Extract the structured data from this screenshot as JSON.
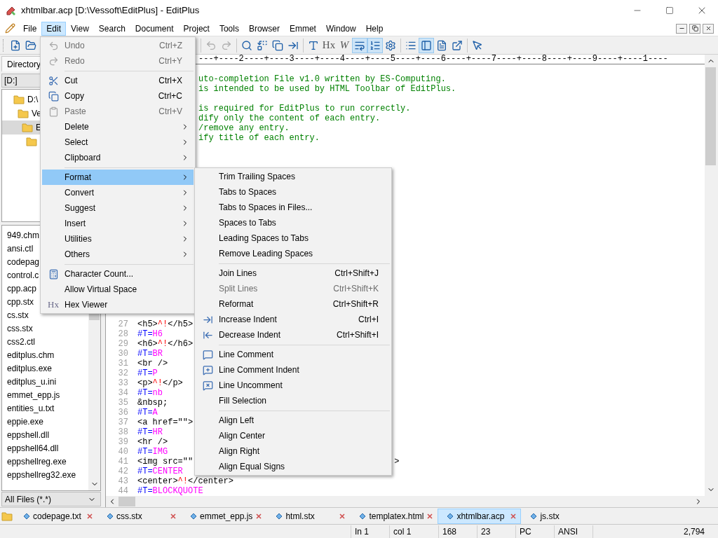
{
  "window": {
    "title": "xhtmlbar.acp [D:\\Vessoft\\EditPlus] - EditPlus"
  },
  "menu_bar": [
    {
      "label": "File",
      "selected": false
    },
    {
      "label": "Edit",
      "selected": true
    },
    {
      "label": "View",
      "selected": false
    },
    {
      "label": "Search",
      "selected": false
    },
    {
      "label": "Document",
      "selected": false
    },
    {
      "label": "Project",
      "selected": false
    },
    {
      "label": "Tools",
      "selected": false
    },
    {
      "label": "Browser",
      "selected": false
    },
    {
      "label": "Emmet",
      "selected": false
    },
    {
      "label": "Window",
      "selected": false
    },
    {
      "label": "Help",
      "selected": false
    }
  ],
  "toolbar": {
    "left": [
      {
        "kind": "button",
        "disabled": false,
        "pressed": false
      },
      {
        "kind": "button",
        "disabled": false,
        "pressed": false
      }
    ],
    "right": [
      {
        "kind": "separator"
      },
      {
        "kind": "button",
        "disabled": true,
        "pressed": false
      },
      {
        "kind": "button",
        "disabled": true,
        "pressed": false
      },
      {
        "kind": "separator"
      },
      {
        "kind": "button",
        "disabled": false,
        "pressed": false
      },
      {
        "kind": "button",
        "disabled": false,
        "pressed": false
      },
      {
        "kind": "button",
        "disabled": false,
        "pressed": false
      },
      {
        "kind": "button",
        "disabled": false,
        "pressed": false
      },
      {
        "kind": "separator"
      },
      {
        "kind": "button",
        "disabled": false,
        "pressed": false
      },
      {
        "kind": "glyph",
        "text": "Hx",
        "italic": false,
        "pressed": false
      },
      {
        "kind": "glyph",
        "text": "W",
        "italic": true,
        "pressed": false
      },
      {
        "kind": "button",
        "disabled": false,
        "pressed": true
      },
      {
        "kind": "button",
        "disabled": false,
        "pressed": true
      },
      {
        "kind": "button",
        "disabled": false,
        "pressed": false
      },
      {
        "kind": "separator"
      },
      {
        "kind": "button",
        "disabled": false,
        "pressed": false
      },
      {
        "kind": "button",
        "disabled": false,
        "pressed": true
      },
      {
        "kind": "button",
        "disabled": false,
        "pressed": false
      },
      {
        "kind": "button",
        "disabled": false,
        "pressed": false
      },
      {
        "kind": "separator"
      },
      {
        "kind": "button",
        "disabled": false,
        "pressed": false
      }
    ]
  },
  "left_panel": {
    "tab": "Directory",
    "drive": "[D:]",
    "tree": [
      {
        "label": "D:\\",
        "selected": false,
        "children": [
          {
            "label": "Ve",
            "selected": false,
            "children": [
              {
                "label": "E",
                "selected": true,
                "children": [
                  {
                    "selected": false
                  }
                ]
              }
            ]
          }
        ]
      }
    ],
    "files": [
      "949.chm",
      "ansi.ctl",
      "codepag",
      "control.c",
      "cpp.acp",
      "cpp.stx",
      "cs.stx",
      "css.stx",
      "css2.ctl",
      "editplus.chm",
      "editplus.exe",
      "editplus_u.ini",
      "emmet_epp.js",
      "entities_u.txt",
      "eppie.exe",
      "eppshell.dll",
      "eppshell64.dll",
      "eppshellreg.exe",
      "eppshellreg32.exe"
    ],
    "filter": "All Files (*.*)"
  },
  "editor": {
    "ruler": "---+----2----+----3----+----4----+----5----+----6----+----7----+----8----+----9----+----1----",
    "top_fragments": [
      [
        "uto-completion File v1.0 written by ES-Computing.",
        "is intended to be used by HTML Toolbar of EditPlus."
      ],
      [
        "is required for EditPlus to run correctly.",
        "dify only the content of each entry.",
        "/remove any entry.",
        "ify title of each entry."
      ]
    ],
    "lines": [
      {
        "number": "27",
        "parts": [
          {
            "kind": "tag",
            "text": "<h5>"
          },
          {
            "kind": "caret",
            "text": "^!"
          },
          {
            "kind": "tag",
            "text": "</h5>"
          }
        ]
      },
      {
        "number": "28",
        "parts": [
          {
            "kind": "directive",
            "text": "#T="
          },
          {
            "kind": "name",
            "text": "H6"
          }
        ]
      },
      {
        "number": "29",
        "parts": [
          {
            "kind": "tag",
            "text": "<h6>"
          },
          {
            "kind": "caret",
            "text": "^!"
          },
          {
            "kind": "tag",
            "text": "</h6>"
          }
        ]
      },
      {
        "number": "30",
        "parts": [
          {
            "kind": "directive",
            "text": "#T="
          },
          {
            "kind": "name",
            "text": "BR"
          }
        ]
      },
      {
        "number": "31",
        "parts": [
          {
            "kind": "tag",
            "text": "<br />"
          }
        ]
      },
      {
        "number": "32",
        "parts": [
          {
            "kind": "directive",
            "text": "#T="
          },
          {
            "kind": "name",
            "text": "P"
          }
        ]
      },
      {
        "number": "33",
        "parts": [
          {
            "kind": "tag",
            "text": "<p>"
          },
          {
            "kind": "caret",
            "text": "^!"
          },
          {
            "kind": "tag",
            "text": "</p>"
          }
        ]
      },
      {
        "number": "34",
        "parts": [
          {
            "kind": "directive",
            "text": "#T="
          },
          {
            "kind": "name",
            "text": "nb"
          }
        ]
      },
      {
        "number": "35",
        "parts": [
          {
            "kind": "tag",
            "text": "&nbsp;"
          }
        ]
      },
      {
        "number": "36",
        "parts": [
          {
            "kind": "directive",
            "text": "#T="
          },
          {
            "kind": "name",
            "text": "A"
          }
        ]
      },
      {
        "number": "37",
        "parts": [
          {
            "kind": "tag",
            "text": "<a href=\"\">"
          }
        ]
      },
      {
        "number": "38",
        "parts": [
          {
            "kind": "directive",
            "text": "#T="
          },
          {
            "kind": "name",
            "text": "HR"
          }
        ]
      },
      {
        "number": "39",
        "parts": [
          {
            "kind": "tag",
            "text": "<hr />"
          }
        ]
      },
      {
        "number": "40",
        "parts": [
          {
            "kind": "directive",
            "text": "#T="
          },
          {
            "kind": "name",
            "text": "IMG"
          }
        ]
      },
      {
        "number": "41",
        "parts": [
          {
            "kind": "tag",
            "text": "<img src=\"\""
          }
        ],
        "tail": ">"
      },
      {
        "number": "42",
        "parts": [
          {
            "kind": "directive",
            "text": "#T="
          },
          {
            "kind": "name",
            "text": "CENTER"
          }
        ]
      },
      {
        "number": "43",
        "parts": [
          {
            "kind": "tag",
            "text": "<center>"
          },
          {
            "kind": "caret",
            "text": "^!"
          },
          {
            "kind": "tag",
            "text": "</center>"
          }
        ]
      },
      {
        "number": "44",
        "parts": [
          {
            "kind": "directive",
            "text": "#T="
          },
          {
            "kind": "name",
            "text": "BLOCKQUOTE"
          }
        ]
      }
    ]
  },
  "edit_menu": [
    {
      "kind": "command",
      "label": "Undo",
      "shortcut": "Ctrl+Z",
      "disabled": true,
      "selected": false
    },
    {
      "kind": "command",
      "label": "Redo",
      "shortcut": "Ctrl+Y",
      "disabled": true,
      "selected": false
    },
    {
      "kind": "separator"
    },
    {
      "kind": "command",
      "label": "Cut",
      "shortcut": "Ctrl+X",
      "disabled": false,
      "selected": false
    },
    {
      "kind": "command",
      "label": "Copy",
      "shortcut": "Ctrl+C",
      "disabled": false,
      "selected": false
    },
    {
      "kind": "command",
      "label": "Paste",
      "shortcut": "Ctrl+V",
      "disabled": true,
      "selected": false
    },
    {
      "kind": "submenu",
      "label": "Delete",
      "disabled": false,
      "selected": false
    },
    {
      "kind": "submenu",
      "label": "Select",
      "disabled": false,
      "selected": false
    },
    {
      "kind": "submenu",
      "label": "Clipboard",
      "disabled": false,
      "selected": false
    },
    {
      "kind": "separator"
    },
    {
      "kind": "submenu",
      "label": "Format",
      "disabled": false,
      "selected": true
    },
    {
      "kind": "submenu",
      "label": "Convert",
      "disabled": false,
      "selected": false
    },
    {
      "kind": "submenu",
      "label": "Suggest",
      "disabled": false,
      "selected": false
    },
    {
      "kind": "submenu",
      "label": "Insert",
      "disabled": false,
      "selected": false
    },
    {
      "kind": "submenu",
      "label": "Utilities",
      "disabled": false,
      "selected": false
    },
    {
      "kind": "submenu",
      "label": "Others",
      "disabled": false,
      "selected": false
    },
    {
      "kind": "separator"
    },
    {
      "kind": "command",
      "label": "Character Count...",
      "disabled": false,
      "selected": false
    },
    {
      "kind": "command",
      "label": "Allow Virtual Space",
      "disabled": false,
      "selected": false
    },
    {
      "kind": "command",
      "label": "Hex Viewer",
      "icon_text": "Hx",
      "disabled": false,
      "selected": false
    }
  ],
  "format_menu": [
    {
      "kind": "command",
      "label": "Trim Trailing Spaces",
      "disabled": false,
      "selected": false
    },
    {
      "kind": "command",
      "label": "Tabs to Spaces",
      "disabled": false,
      "selected": false
    },
    {
      "kind": "command",
      "label": "Tabs to Spaces in Files...",
      "disabled": false,
      "selected": false
    },
    {
      "kind": "command",
      "label": "Spaces to Tabs",
      "disabled": false,
      "selected": false
    },
    {
      "kind": "command",
      "label": "Leading Spaces to Tabs",
      "disabled": false,
      "selected": false
    },
    {
      "kind": "command",
      "label": "Remove Leading Spaces",
      "disabled": false,
      "selected": false
    },
    {
      "kind": "separator"
    },
    {
      "kind": "command",
      "label": "Join Lines",
      "shortcut": "Ctrl+Shift+J",
      "disabled": false,
      "selected": false
    },
    {
      "kind": "command",
      "label": "Split Lines",
      "shortcut": "Ctrl+Shift+K",
      "disabled": true,
      "selected": false
    },
    {
      "kind": "command",
      "label": "Reformat",
      "shortcut": "Ctrl+Shift+R",
      "disabled": false,
      "selected": false
    },
    {
      "kind": "command",
      "label": "Increase Indent",
      "shortcut": "Ctrl+I",
      "disabled": false,
      "selected": false
    },
    {
      "kind": "command",
      "label": "Decrease Indent",
      "shortcut": "Ctrl+Shift+I",
      "disabled": false,
      "selected": false
    },
    {
      "kind": "separator"
    },
    {
      "kind": "command",
      "label": "Line Comment",
      "disabled": false,
      "selected": false
    },
    {
      "kind": "command",
      "label": "Line Comment Indent",
      "disabled": false,
      "selected": false
    },
    {
      "kind": "command",
      "label": "Line Uncomment",
      "disabled": false,
      "selected": false
    },
    {
      "kind": "command",
      "label": "Fill Selection",
      "disabled": false,
      "selected": false
    },
    {
      "kind": "separator"
    },
    {
      "kind": "command",
      "label": "Align Left",
      "disabled": false,
      "selected": false
    },
    {
      "kind": "command",
      "label": "Align Center",
      "disabled": false,
      "selected": false
    },
    {
      "kind": "command",
      "label": "Align Right",
      "disabled": false,
      "selected": false
    },
    {
      "kind": "command",
      "label": "Align Equal Signs",
      "disabled": false,
      "selected": false
    }
  ],
  "file_tabs": [
    {
      "label": "codepage.txt",
      "selected": false,
      "closable": true
    },
    {
      "label": "css.stx",
      "selected": false,
      "closable": true
    },
    {
      "label": "emmet_epp.js",
      "selected": false,
      "closable": true
    },
    {
      "label": "html.stx",
      "selected": false,
      "closable": true
    },
    {
      "label": "templatex.html",
      "selected": false,
      "closable": true
    },
    {
      "label": "xhtmlbar.acp",
      "selected": true,
      "closable": true
    },
    {
      "label": "js.stx",
      "selected": false,
      "closable": false
    }
  ],
  "status_bar": [
    "In 1",
    "col 1",
    "168",
    "23",
    "PC",
    "ANSI",
    "2,794"
  ]
}
